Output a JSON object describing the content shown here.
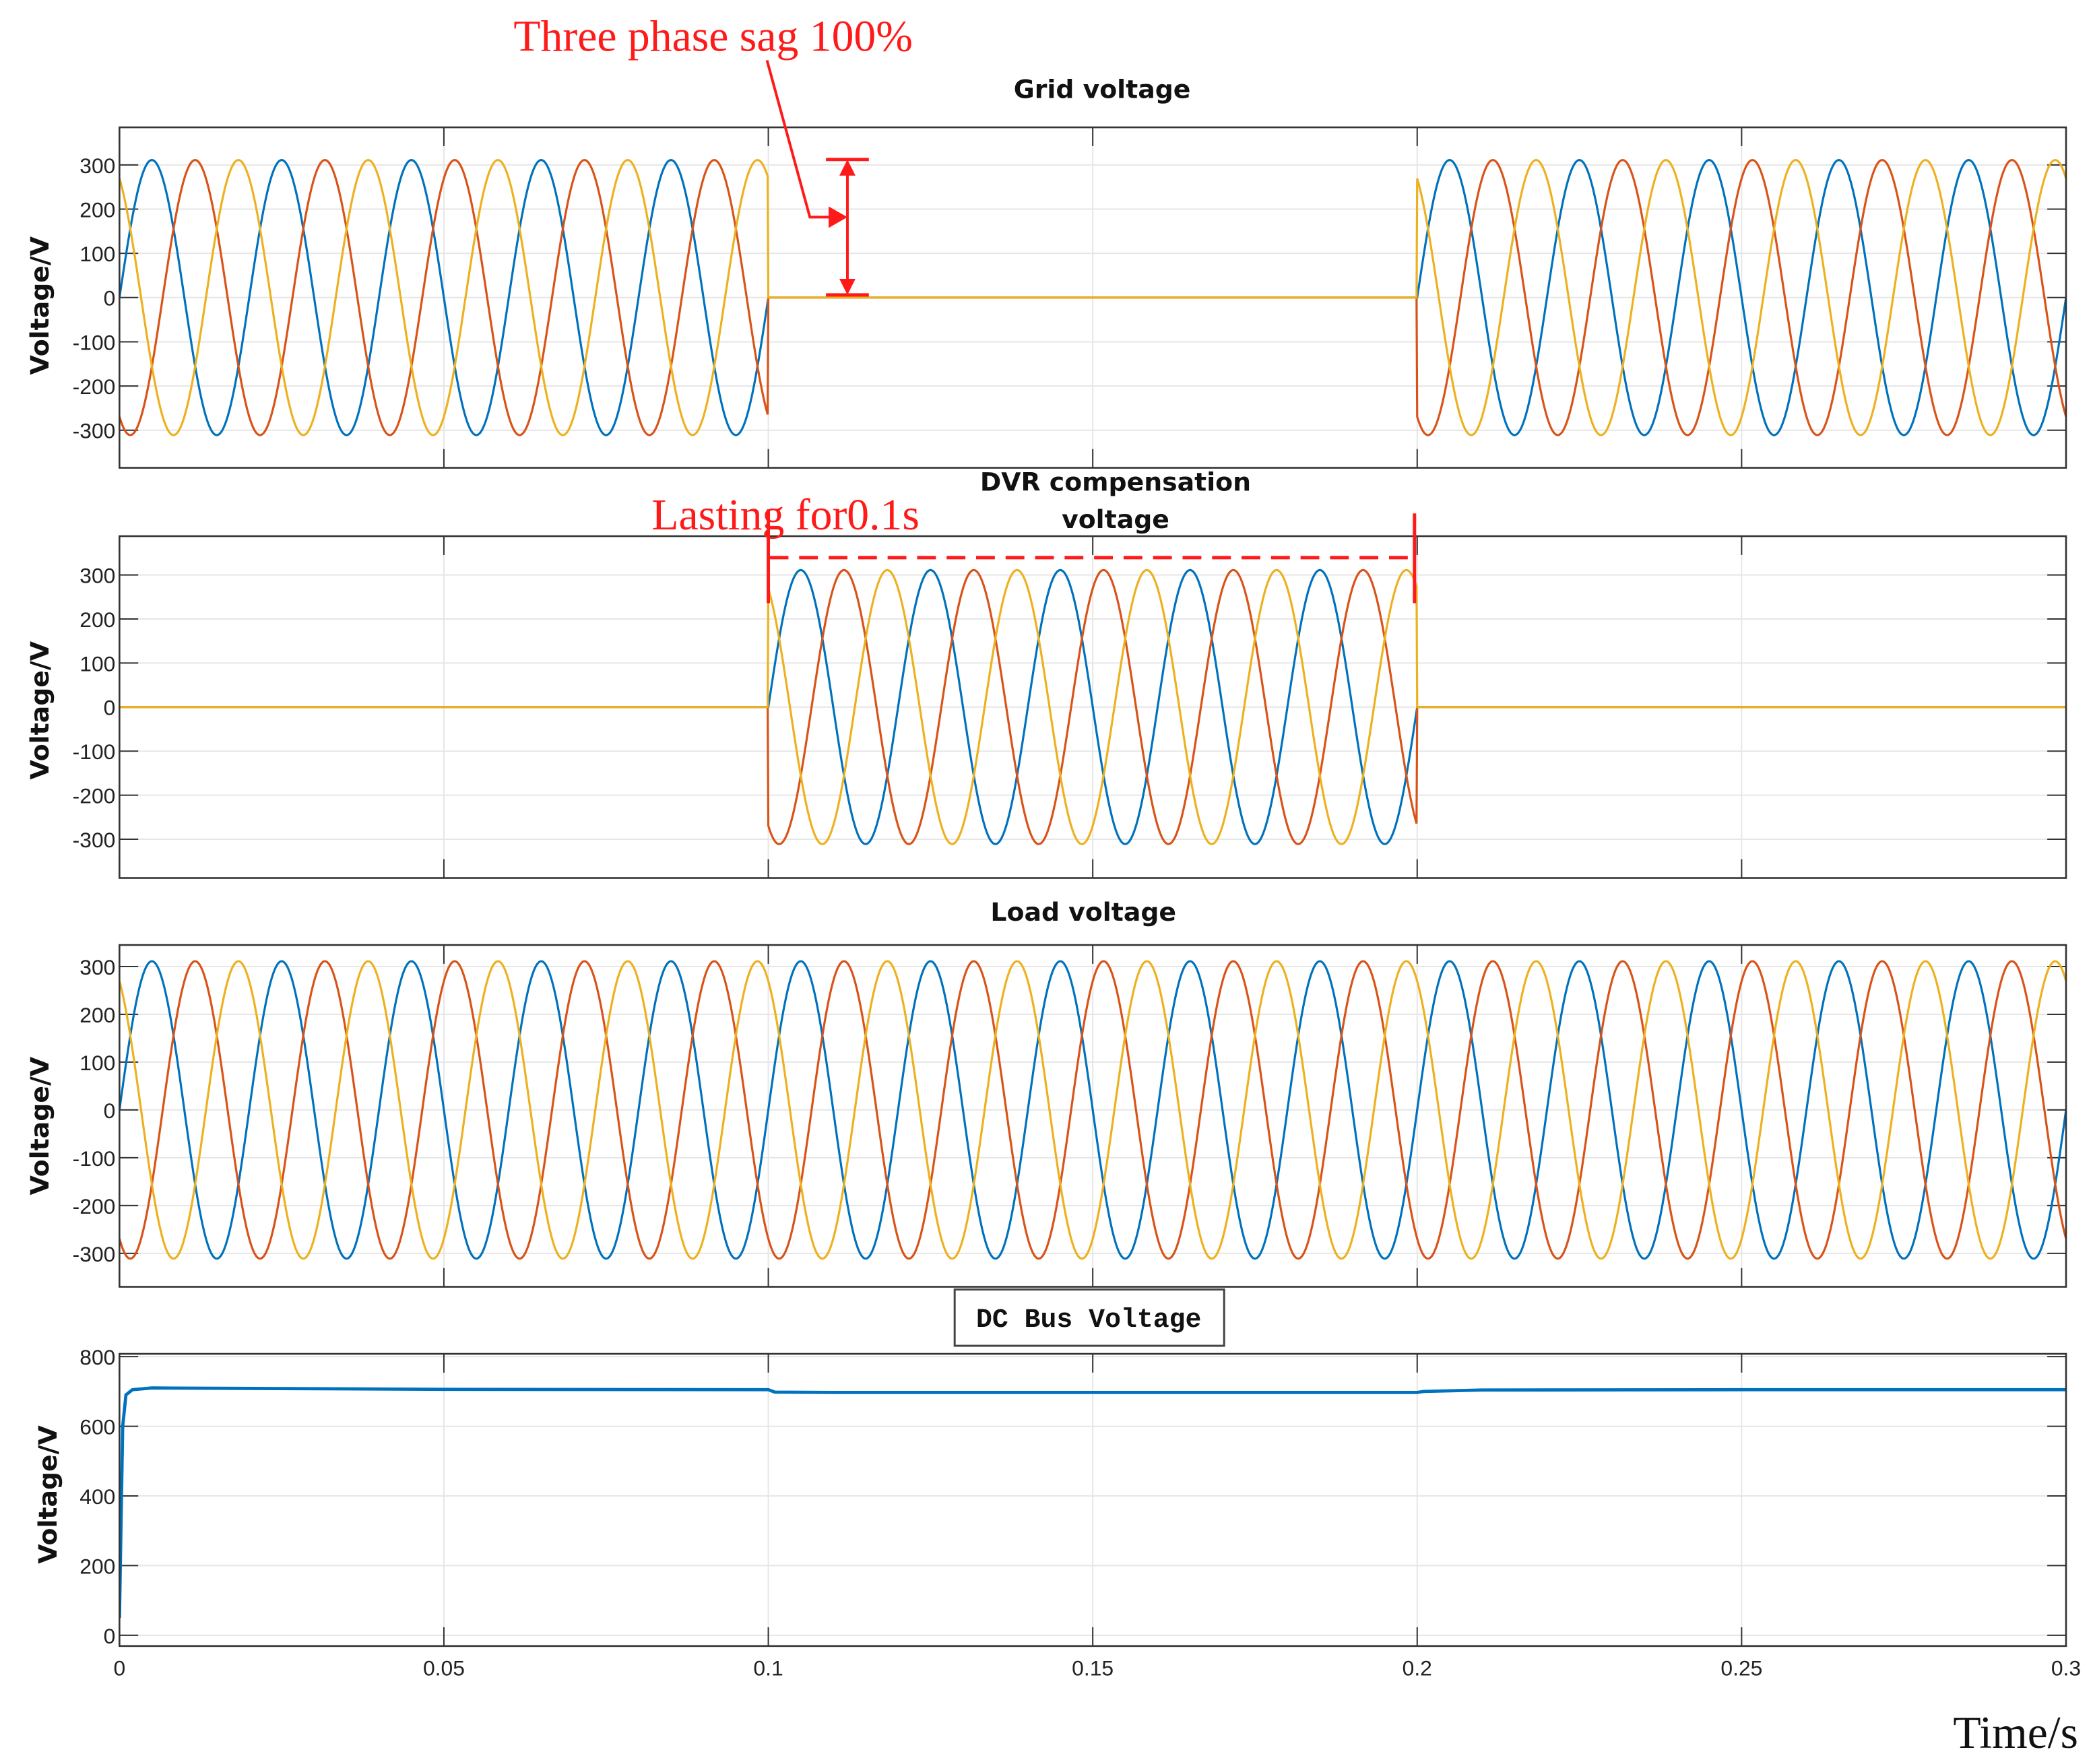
{
  "chart_data": [
    {
      "type": "line",
      "title": "Grid voltage",
      "ylabel": "Voltage/V",
      "xlim": [
        0,
        0.3
      ],
      "ylim": [
        -385,
        385
      ],
      "yticks": [
        300,
        200,
        100,
        0,
        -100,
        -200,
        -300
      ],
      "grid": true,
      "signal": "three-phase sine, zero during sag",
      "amplitude": 311,
      "frequency_hz": 50,
      "sag_interval": [
        0.1,
        0.2
      ],
      "series": [
        {
          "color": "#0072BD",
          "phase_deg": 0
        },
        {
          "color": "#D95319",
          "phase_deg": -120
        },
        {
          "color": "#EDB120",
          "phase_deg": 120
        }
      ]
    },
    {
      "type": "line",
      "title_line1": "DVR compensation",
      "title_line2": "voltage",
      "ylabel": "Voltage/V",
      "xlim": [
        0,
        0.3
      ],
      "ylim": [
        -388,
        388
      ],
      "yticks": [
        300,
        200,
        100,
        0,
        -100,
        -200,
        -300
      ],
      "grid": true,
      "signal": "three-phase sine only during sag, ~0 otherwise",
      "amplitude": 311,
      "frequency_hz": 50,
      "active_interval": [
        0.1,
        0.2
      ],
      "series": [
        {
          "color": "#0072BD",
          "phase_deg": 0
        },
        {
          "color": "#D95319",
          "phase_deg": -120
        },
        {
          "color": "#EDB120",
          "phase_deg": 120
        }
      ]
    },
    {
      "type": "line",
      "title": "Load voltage",
      "ylabel": "Voltage/V",
      "xlim": [
        0,
        0.3
      ],
      "ylim": [
        -370,
        345
      ],
      "yticks": [
        300,
        200,
        100,
        0,
        -100,
        -200,
        -300
      ],
      "grid": true,
      "signal": "continuous three-phase sine",
      "amplitude": 311,
      "frequency_hz": 50,
      "series": [
        {
          "color": "#0072BD",
          "phase_deg": 0
        },
        {
          "color": "#D95319",
          "phase_deg": -120
        },
        {
          "color": "#EDB120",
          "phase_deg": 120
        }
      ]
    },
    {
      "type": "line",
      "title": "DC Bus Voltage",
      "ylabel": "Voltage/V",
      "xlabel": "Time/s",
      "xlim": [
        0,
        0.3
      ],
      "ylim": [
        -31,
        808
      ],
      "yticks": [
        800,
        600,
        400,
        200,
        0
      ],
      "xticks": [
        "0",
        "0.05",
        "0.1",
        "0.15",
        "0.2",
        "0.25",
        "0.3"
      ],
      "grid": true,
      "series": [
        {
          "color": "#0072BD",
          "x": [
            0,
            0.0005,
            0.001,
            0.002,
            0.005,
            0.05,
            0.1,
            0.101,
            0.11,
            0.13,
            0.15,
            0.2,
            0.201,
            0.21,
            0.25,
            0.3
          ],
          "y": [
            50,
            600,
            690,
            705,
            710,
            706,
            705,
            698,
            697,
            697,
            697,
            697,
            700,
            704,
            705,
            705
          ]
        }
      ]
    }
  ],
  "annotations": {
    "sag_label": "Three phase sag  100%",
    "duration_label": "Lasting for0.1s"
  },
  "colors": {
    "annotation": "#ff1a1a"
  }
}
